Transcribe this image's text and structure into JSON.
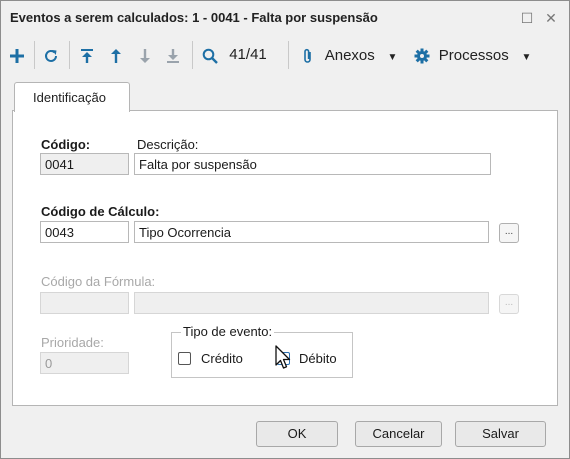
{
  "window": {
    "title": "Eventos a serem calculados: 1 - 0041 - Falta por suspensão",
    "maximize_glyph": "☐",
    "close_glyph": "✕"
  },
  "toolbar": {
    "add_icon": "plus-icon",
    "refresh_icon": "refresh-icon",
    "first_icon": "first-record-icon",
    "previous_icon": "previous-record-icon",
    "next_icon": "next-record-icon",
    "last_icon": "last-record-icon",
    "search_icon": "search-icon",
    "record_counter": "41/41",
    "attachments_label": "Anexos",
    "processes_label": "Processos"
  },
  "tabs": [
    {
      "label": "Identificação"
    }
  ],
  "form": {
    "codigo_label": "Código:",
    "codigo_value": "0041",
    "descricao_label": "Descrição:",
    "descricao_value": "Falta por suspensão",
    "codigo_calculo_label": "Código de Cálculo:",
    "codigo_calculo_value": "0043",
    "codigo_calculo_desc": "Tipo Ocorrencia",
    "ellipsis": "...",
    "codigo_formula_label": "Código da Fórmula:",
    "codigo_formula_value": "",
    "codigo_formula_desc": "",
    "prioridade_label": "Prioridade:",
    "prioridade_value": "0",
    "tipo_evento_label": "Tipo de evento:",
    "credito_label": "Crédito",
    "credito_checked": false,
    "debito_label": "Débito",
    "debito_checked": false
  },
  "footer": {
    "ok_label": "OK",
    "cancel_label": "Cancelar",
    "save_label": "Salvar"
  },
  "colors": {
    "toolbar_icon": "#1d6fa5",
    "toolbar_icon_disabled": "#9aa3ac",
    "window_bg": "#f0f0f0",
    "panel_bg": "#ffffff"
  }
}
